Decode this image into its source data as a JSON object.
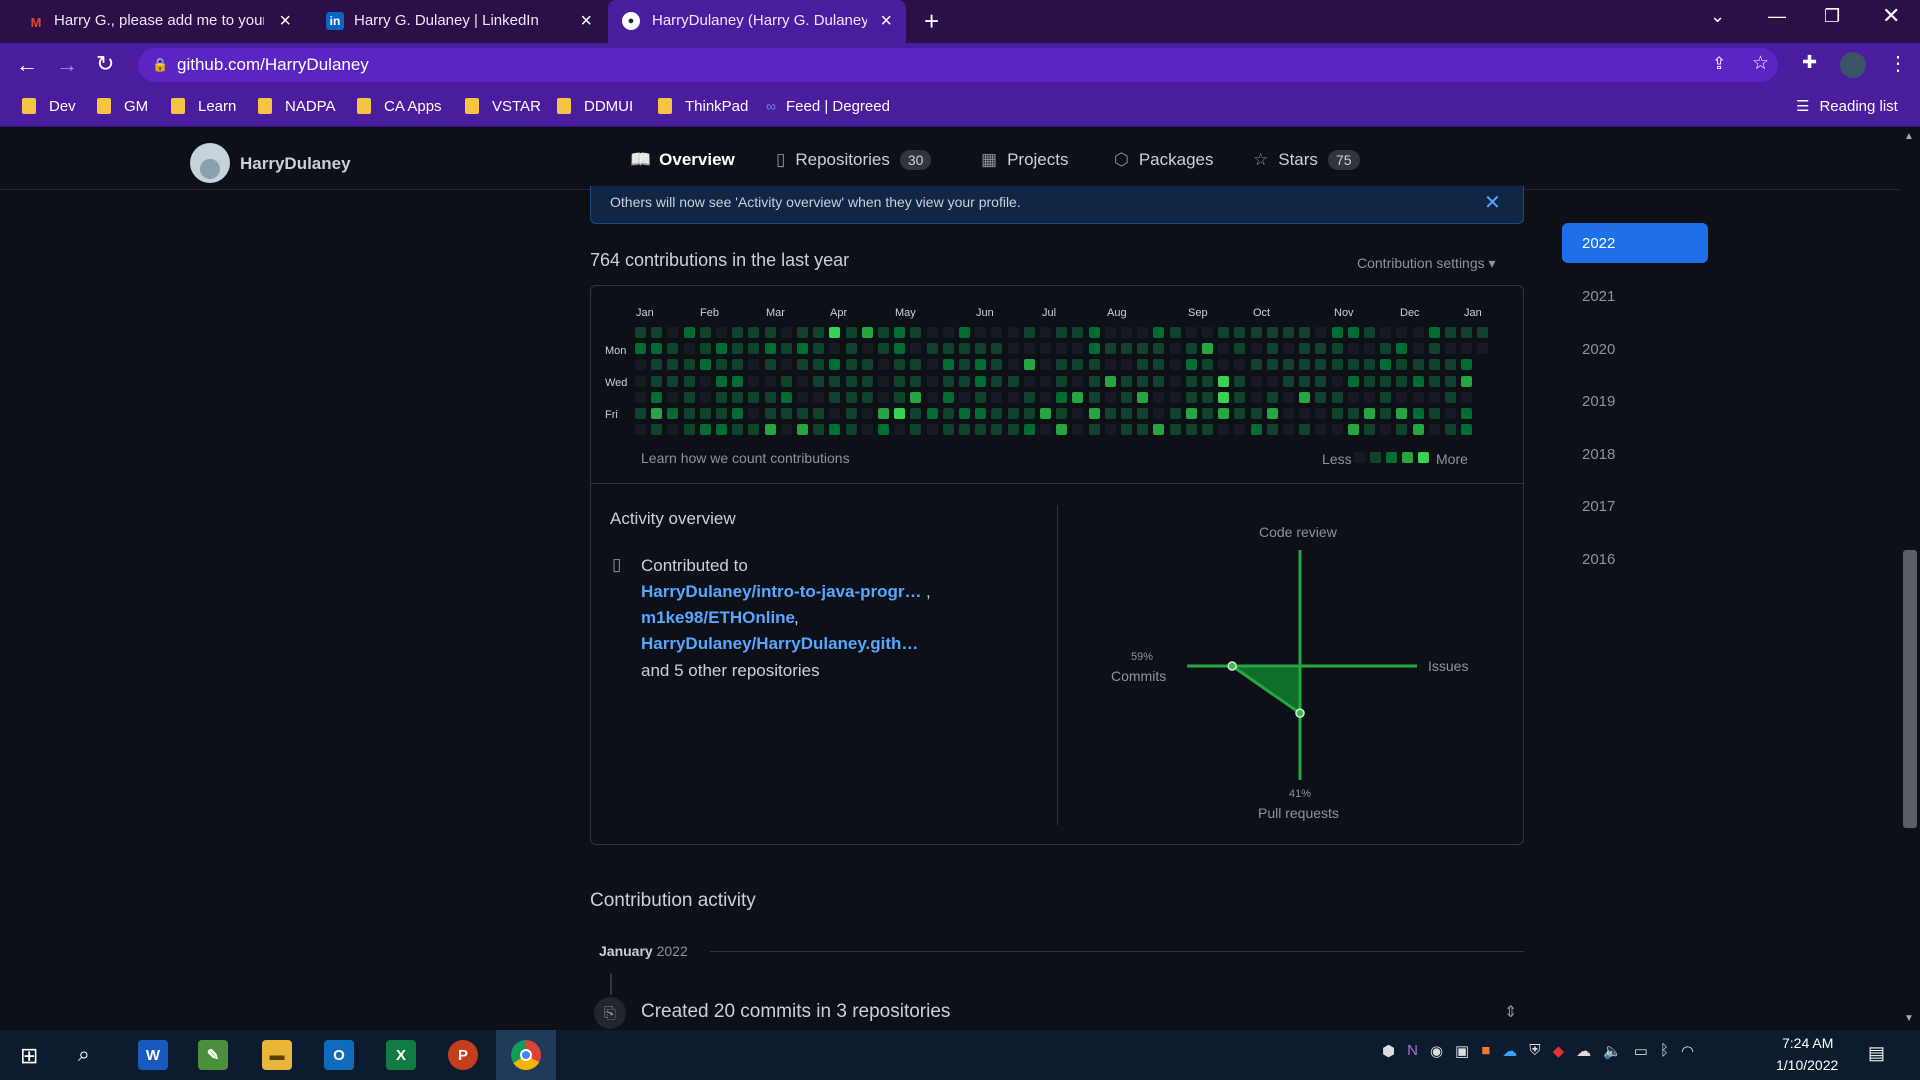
{
  "browser": {
    "tabs": [
      {
        "label": "Harry G., please add me to your L",
        "icon": "gmail-icon"
      },
      {
        "label": "Harry G. Dulaney | LinkedIn",
        "icon": "linkedin-icon"
      },
      {
        "label": "HarryDulaney (Harry G. Dulaney)",
        "icon": "github-icon"
      }
    ],
    "url": "github.com/HarryDulaney",
    "bookmarks": [
      "Dev",
      "GM",
      "Learn",
      "NADPA",
      "CA Apps",
      "VSTAR",
      "DDMUI",
      "ThinkPad",
      "Feed | Degreed"
    ],
    "reading_list": "Reading list"
  },
  "profile": {
    "username": "HarryDulaney",
    "tabs": [
      {
        "label": "Overview"
      },
      {
        "label": "Repositories",
        "count": "30"
      },
      {
        "label": "Projects"
      },
      {
        "label": "Packages"
      },
      {
        "label": "Stars",
        "count": "75"
      }
    ]
  },
  "flash": {
    "message": "Others will now see 'Activity overview' when they view your profile."
  },
  "contributions": {
    "heading": "764 contributions in the last year",
    "settings": "Contribution settings",
    "months": [
      "Jan",
      "Feb",
      "Mar",
      "Apr",
      "May",
      "Jun",
      "Jul",
      "Aug",
      "Sep",
      "Oct",
      "Nov",
      "Dec",
      "Jan"
    ],
    "days": [
      "Mon",
      "Wed",
      "Fri"
    ],
    "learn_link": "Learn how we count contributions",
    "legend_less": "Less",
    "legend_more": "More",
    "level_colors": [
      "#161b22",
      "#0e4429",
      "#006d32",
      "#26a641",
      "#39d353"
    ]
  },
  "years": [
    "2022",
    "2021",
    "2020",
    "2019",
    "2018",
    "2017",
    "2016"
  ],
  "activity": {
    "title": "Activity overview",
    "contributed_to": "Contributed to",
    "repos": [
      "HarryDulaney/intro-to-java-progr…",
      "m1ke98/ETHOnline",
      "HarryDulaney/HarryDulaney.gith…"
    ],
    "other": "and 5 other repositories",
    "code_review": "Code review",
    "issues": "Issues",
    "commits_pct": "59%",
    "commits": "Commits",
    "pr_pct": "41%",
    "pull_requests": "Pull requests"
  },
  "chart_data": {
    "type": "radar",
    "categories": [
      "Code review",
      "Issues",
      "Pull requests",
      "Commits"
    ],
    "values": [
      0,
      0,
      41,
      59
    ],
    "unit": "%"
  },
  "contribution_activity": {
    "title": "Contribution activity",
    "month": "January",
    "year": "2022",
    "summary": "Created 20 commits in 3 repositories"
  },
  "taskbar": {
    "time": "7:24 AM",
    "date": "1/10/2022"
  }
}
